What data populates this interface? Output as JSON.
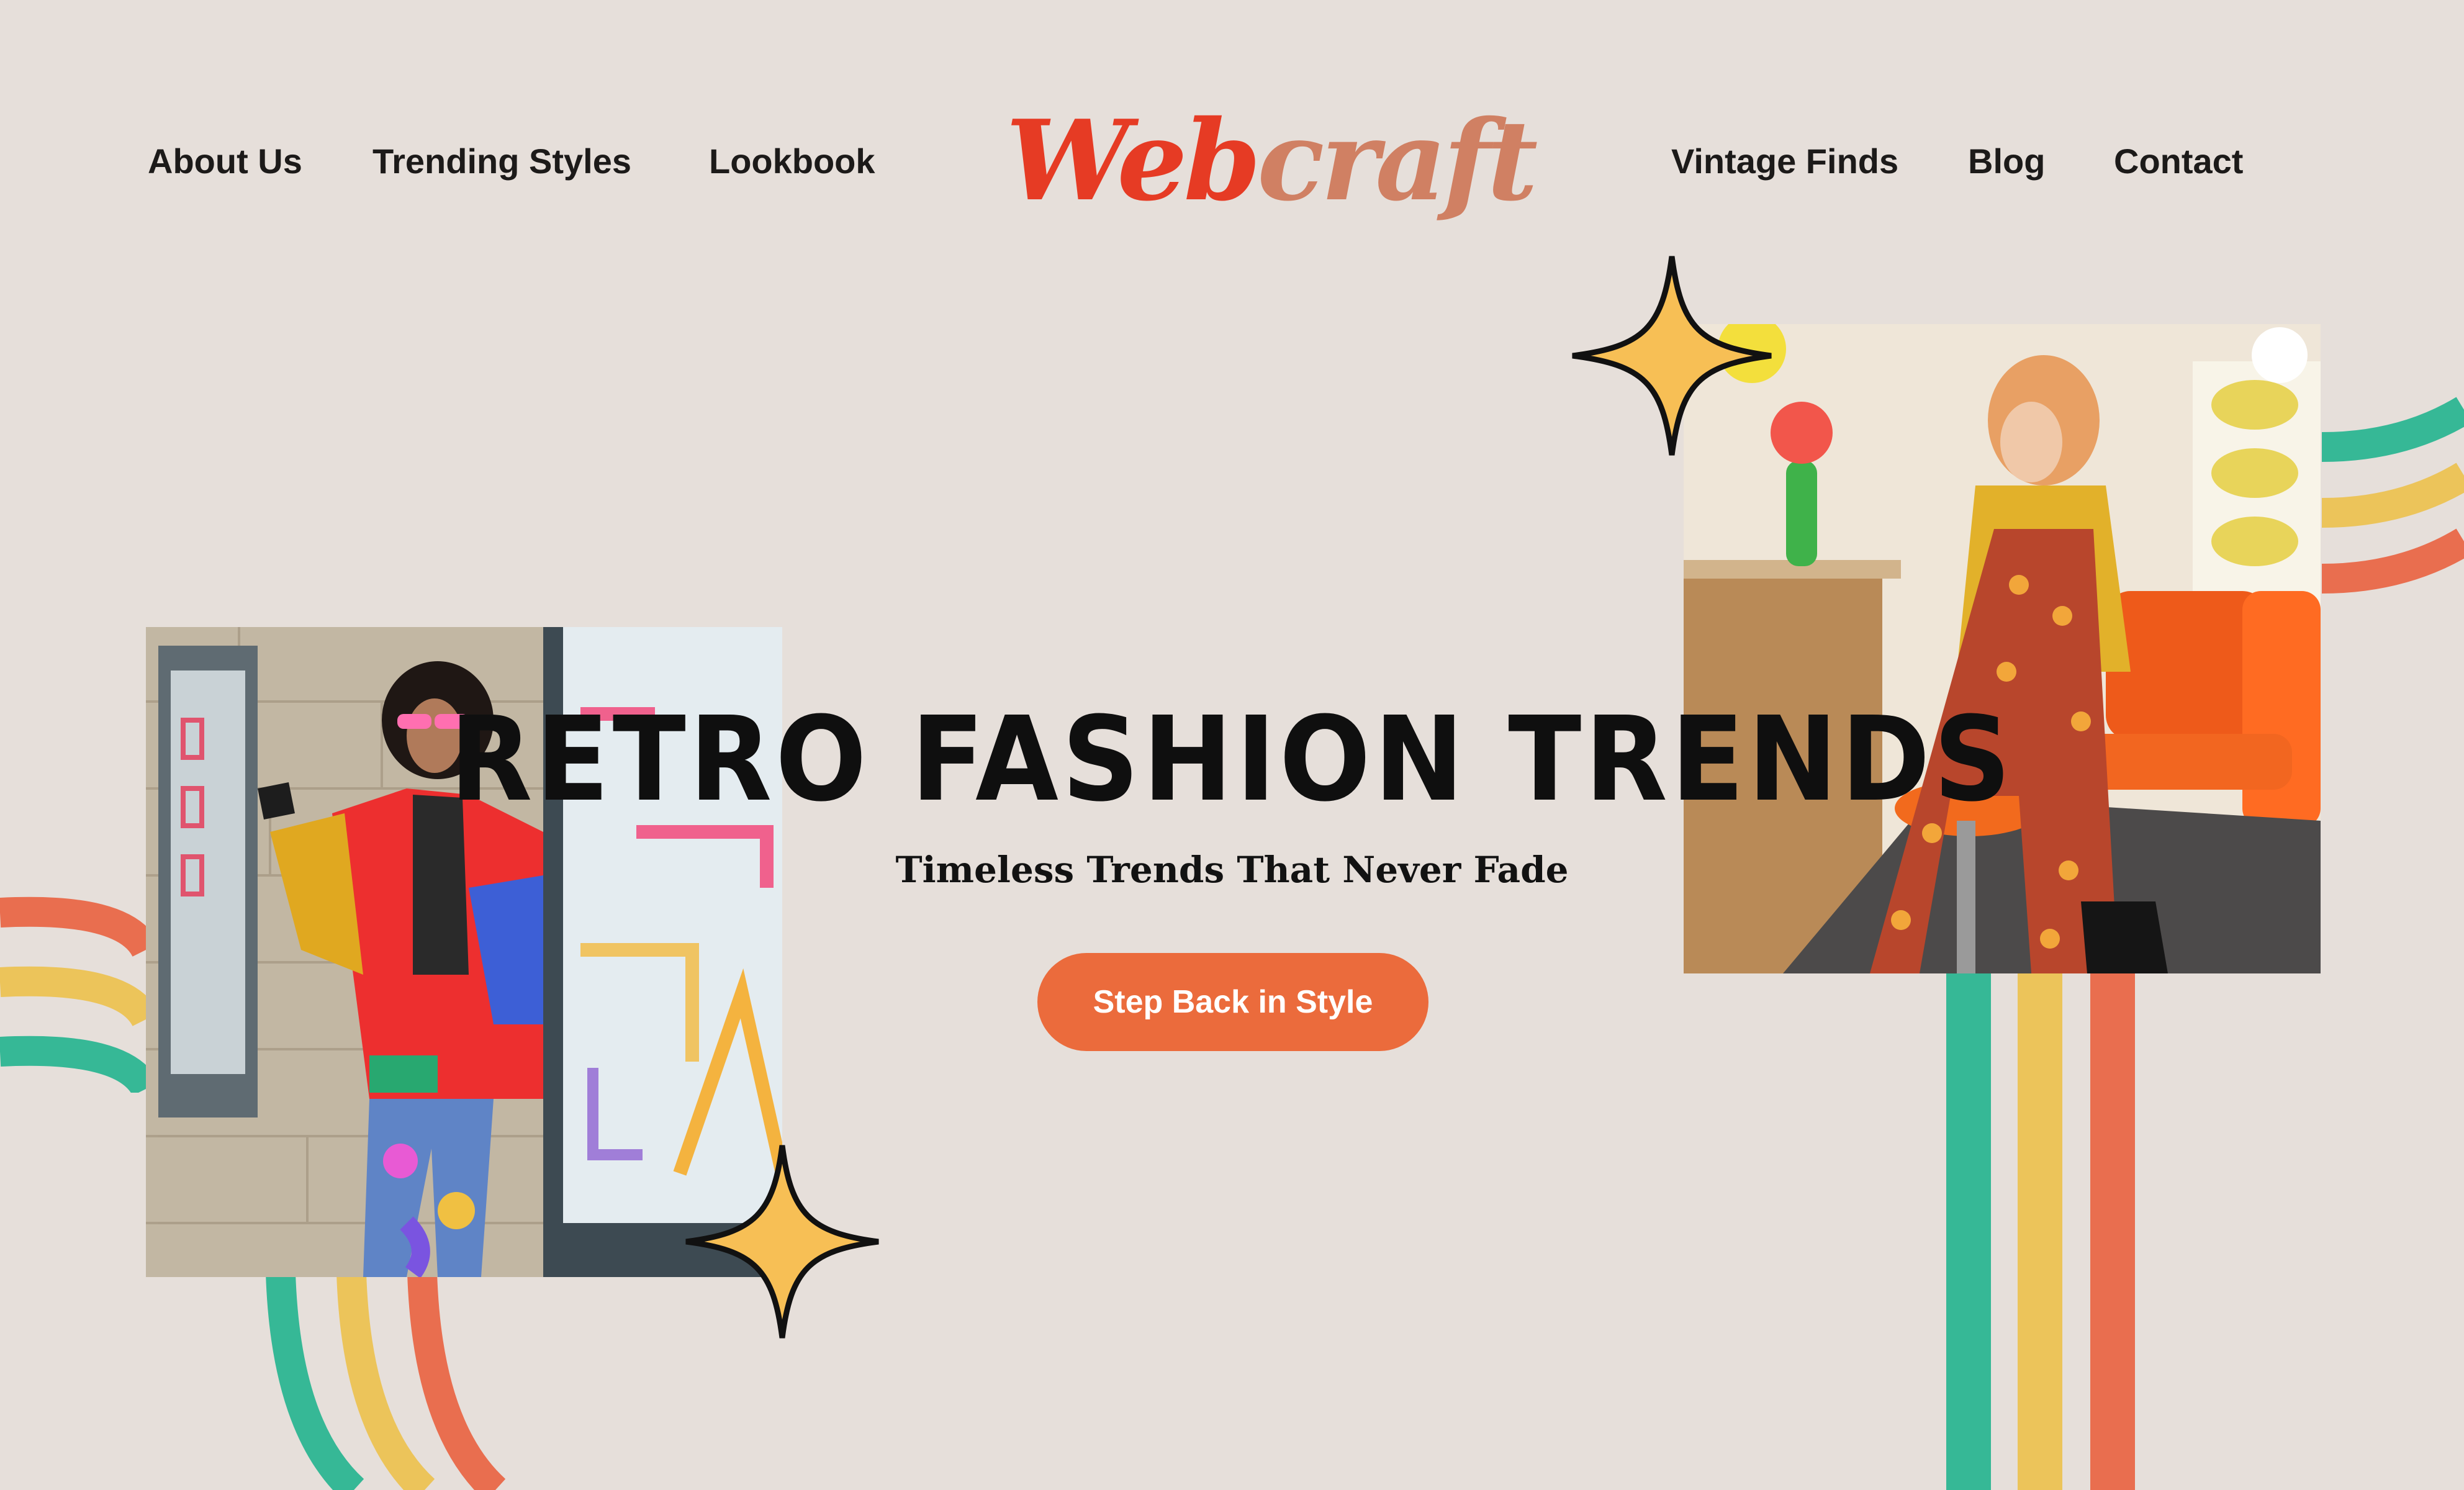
{
  "nav": {
    "left": [
      "About Us",
      "Trending Styles",
      "Lookbook"
    ],
    "right": [
      "Vintage Finds",
      "Blog",
      "Contact"
    ]
  },
  "logo": {
    "part1": "Web",
    "part2": "craft"
  },
  "hero": {
    "title": "RETRO FASHION TRENDS",
    "subtitle": "Timeless Trends That Never Fade",
    "cta": "Step Back in Style"
  },
  "colors": {
    "background": "#e6dfda",
    "green": "#36b896",
    "yellow": "#ecc45a",
    "coral": "#e96e4f",
    "logo_red": "#e63b24",
    "logo_terracotta": "#d08063",
    "cta": "#eb6b3c",
    "star": "#f7bf55"
  },
  "icons": [
    "sparkle-star-icon",
    "sparkle-star-icon"
  ]
}
